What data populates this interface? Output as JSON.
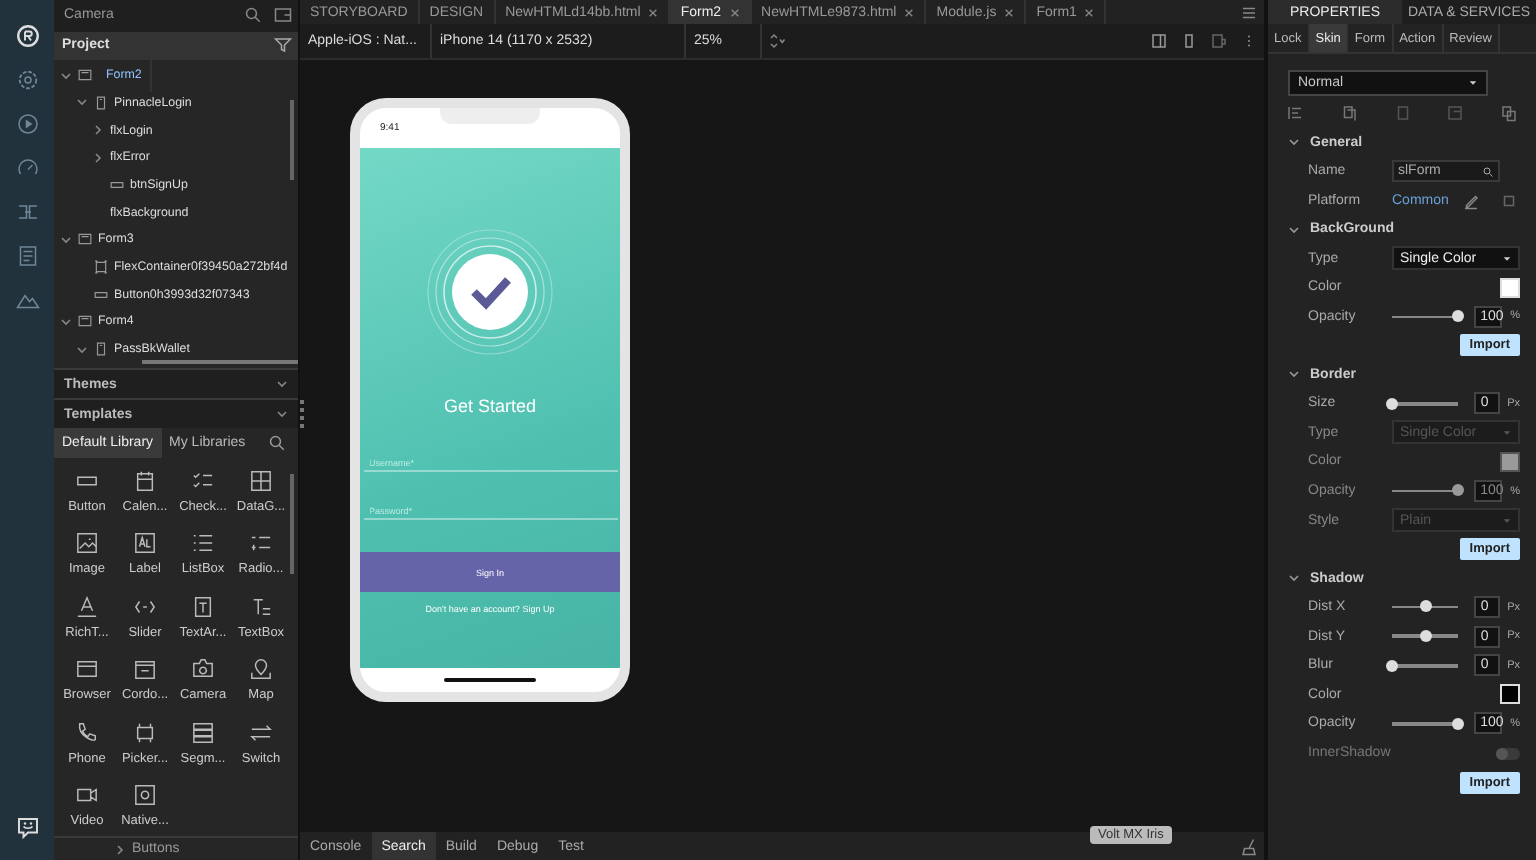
{
  "left_panel": {
    "search": {
      "value": "Camera"
    },
    "project": {
      "title": "Project",
      "tree": [
        {
          "label": "Form2",
          "kind": "form",
          "selected": true,
          "expanded": true,
          "children": [
            {
              "label": "PinnacleLogin",
              "kind": "page",
              "selected": false,
              "expanded": true,
              "children": [
                {
                  "label": "flxLogin",
                  "kind": "flex",
                  "selected": false,
                  "expanded": false
                },
                {
                  "label": "flxError",
                  "kind": "flex",
                  "selected": false,
                  "expanded": false
                },
                {
                  "label": "btnSignUp",
                  "kind": "button",
                  "selected": false
                },
                {
                  "label": "flxBackground",
                  "kind": "flex",
                  "selected": false
                }
              ]
            }
          ]
        },
        {
          "label": "Form3",
          "kind": "form",
          "selected": false,
          "expanded": true,
          "children": [
            {
              "label": "FlexContainer0f39450a272bf4d",
              "kind": "container",
              "selected": false
            },
            {
              "label": "Button0h3993d32f07343",
              "kind": "button",
              "selected": false
            }
          ]
        },
        {
          "label": "Form4",
          "kind": "form",
          "selected": false,
          "expanded": true,
          "children": [
            {
              "label": "PassBkWallet",
              "kind": "page",
              "selected": false,
              "expanded": true
            }
          ]
        }
      ]
    },
    "sections": [
      {
        "title": "Themes"
      },
      {
        "title": "Templates"
      }
    ],
    "library": {
      "tabs": [
        {
          "label": "Default Library",
          "selected": true
        },
        {
          "label": "My Libraries",
          "selected": false
        }
      ],
      "widgets": [
        {
          "label": "Button",
          "kind": "button"
        },
        {
          "label": "Calen...",
          "kind": "calendar"
        },
        {
          "label": "Check...",
          "kind": "checklist"
        },
        {
          "label": "DataG...",
          "kind": "grid"
        },
        {
          "label": "Image",
          "kind": "image"
        },
        {
          "label": "Label",
          "kind": "label"
        },
        {
          "label": "ListBox",
          "kind": "list"
        },
        {
          "label": "Radio...",
          "kind": "radio"
        },
        {
          "label": "RichT...",
          "kind": "richtext"
        },
        {
          "label": "Slider",
          "kind": "slider"
        },
        {
          "label": "TextAr...",
          "kind": "textarea"
        },
        {
          "label": "TextBox",
          "kind": "textbox"
        },
        {
          "label": "Browser",
          "kind": "browser"
        },
        {
          "label": "Cordo...",
          "kind": "cordova"
        },
        {
          "label": "Camera",
          "kind": "camera"
        },
        {
          "label": "Map",
          "kind": "map"
        },
        {
          "label": "Phone",
          "kind": "phone"
        },
        {
          "label": "Picker...",
          "kind": "picker"
        },
        {
          "label": "Segm...",
          "kind": "segment"
        },
        {
          "label": "Switch",
          "kind": "switch"
        },
        {
          "label": "Video",
          "kind": "video"
        },
        {
          "label": "Native...",
          "kind": "native"
        }
      ],
      "group": "Buttons"
    }
  },
  "editor": {
    "tabs": [
      {
        "label": "STORYBOARD",
        "selected": false,
        "closable": false
      },
      {
        "label": "DESIGN",
        "selected": false,
        "closable": false
      },
      {
        "label": "NewHTMLd14bb.html",
        "selected": false,
        "closable": true
      },
      {
        "label": "Form2",
        "selected": true,
        "closable": true
      },
      {
        "label": "NewHTMLe9873.html",
        "selected": false,
        "closable": true
      },
      {
        "label": "Module.js",
        "selected": false,
        "closable": true
      },
      {
        "label": "Form1",
        "selected": false,
        "closable": true
      }
    ],
    "toolbar": {
      "platform": "Apple-iOS : Nat...",
      "device": "iPhone 14 (1170 x 2532)",
      "zoom": "25%"
    },
    "phone": {
      "time": "9:41",
      "title": "Get Started",
      "fields": [
        {
          "placeholder": "Username*"
        },
        {
          "placeholder": "Password*"
        }
      ],
      "button": "Sign In",
      "footer": "Don't have an account? Sign Up"
    },
    "bottom_tabs": [
      {
        "label": "Console",
        "selected": false
      },
      {
        "label": "Search",
        "selected": true
      },
      {
        "label": "Build",
        "selected": false
      },
      {
        "label": "Debug",
        "selected": false
      },
      {
        "label": "Test",
        "selected": false
      }
    ],
    "tooltip": "Volt MX Iris"
  },
  "properties": {
    "tabs": [
      {
        "label": "PROPERTIES",
        "selected": true
      },
      {
        "label": "DATA & SERVICES",
        "selected": false
      }
    ],
    "subtabs": [
      {
        "label": "Lock",
        "selected": false
      },
      {
        "label": "Skin",
        "selected": true
      },
      {
        "label": "Form",
        "selected": false
      },
      {
        "label": "Action",
        "selected": false
      },
      {
        "label": "Review",
        "selected": false
      }
    ],
    "state": "Normal",
    "sections": [
      {
        "title": "General",
        "expanded": true,
        "rows": [
          {
            "kind": "field",
            "label": "Name",
            "value": "slForm"
          },
          {
            "kind": "link",
            "label": "Platform",
            "value": "Common"
          }
        ]
      },
      {
        "title": "BackGround",
        "expanded": true,
        "rows": [
          {
            "kind": "select",
            "label": "Type",
            "value": "Single Color",
            "disabled": false
          },
          {
            "kind": "color",
            "label": "Color",
            "color": "#ffffff",
            "disabled": false
          },
          {
            "kind": "slider",
            "label": "Opacity",
            "level": 1,
            "value": "100",
            "unit": "%",
            "disabled": false
          },
          {
            "kind": "button",
            "label": "Import"
          }
        ]
      },
      {
        "title": "Border",
        "expanded": true,
        "rows": [
          {
            "kind": "slider",
            "label": "Size",
            "level": 0,
            "value": "0",
            "unit": "Px",
            "disabled": false
          },
          {
            "kind": "select",
            "label": "Type",
            "value": "Single Color",
            "disabled": true
          },
          {
            "kind": "color",
            "label": "Color",
            "color": "#9a9a9a",
            "disabled": true
          },
          {
            "kind": "slider",
            "label": "Opacity",
            "level": 1,
            "value": "100",
            "unit": "%",
            "disabled": true
          },
          {
            "kind": "select",
            "label": "Style",
            "value": "Plain",
            "disabled": true
          },
          {
            "kind": "button",
            "label": "Import"
          }
        ]
      },
      {
        "title": "Shadow",
        "expanded": true,
        "rows": [
          {
            "kind": "slider",
            "label": "Dist X",
            "level": 0.5,
            "value": "0",
            "unit": "Px",
            "disabled": false
          },
          {
            "kind": "slider",
            "label": "Dist Y",
            "level": 0.5,
            "value": "0",
            "unit": "Px",
            "disabled": false
          },
          {
            "kind": "slider",
            "label": "Blur",
            "level": 0,
            "value": "0",
            "unit": "Px",
            "disabled": false
          },
          {
            "kind": "color",
            "label": "Color",
            "color": "#000000",
            "disabled": false
          },
          {
            "kind": "slider",
            "label": "Opacity",
            "level": 1,
            "value": "100",
            "unit": "%",
            "disabled": false
          },
          {
            "kind": "toggle",
            "label": "InnerShadow",
            "on": false
          },
          {
            "kind": "button",
            "label": "Import"
          }
        ]
      }
    ]
  }
}
